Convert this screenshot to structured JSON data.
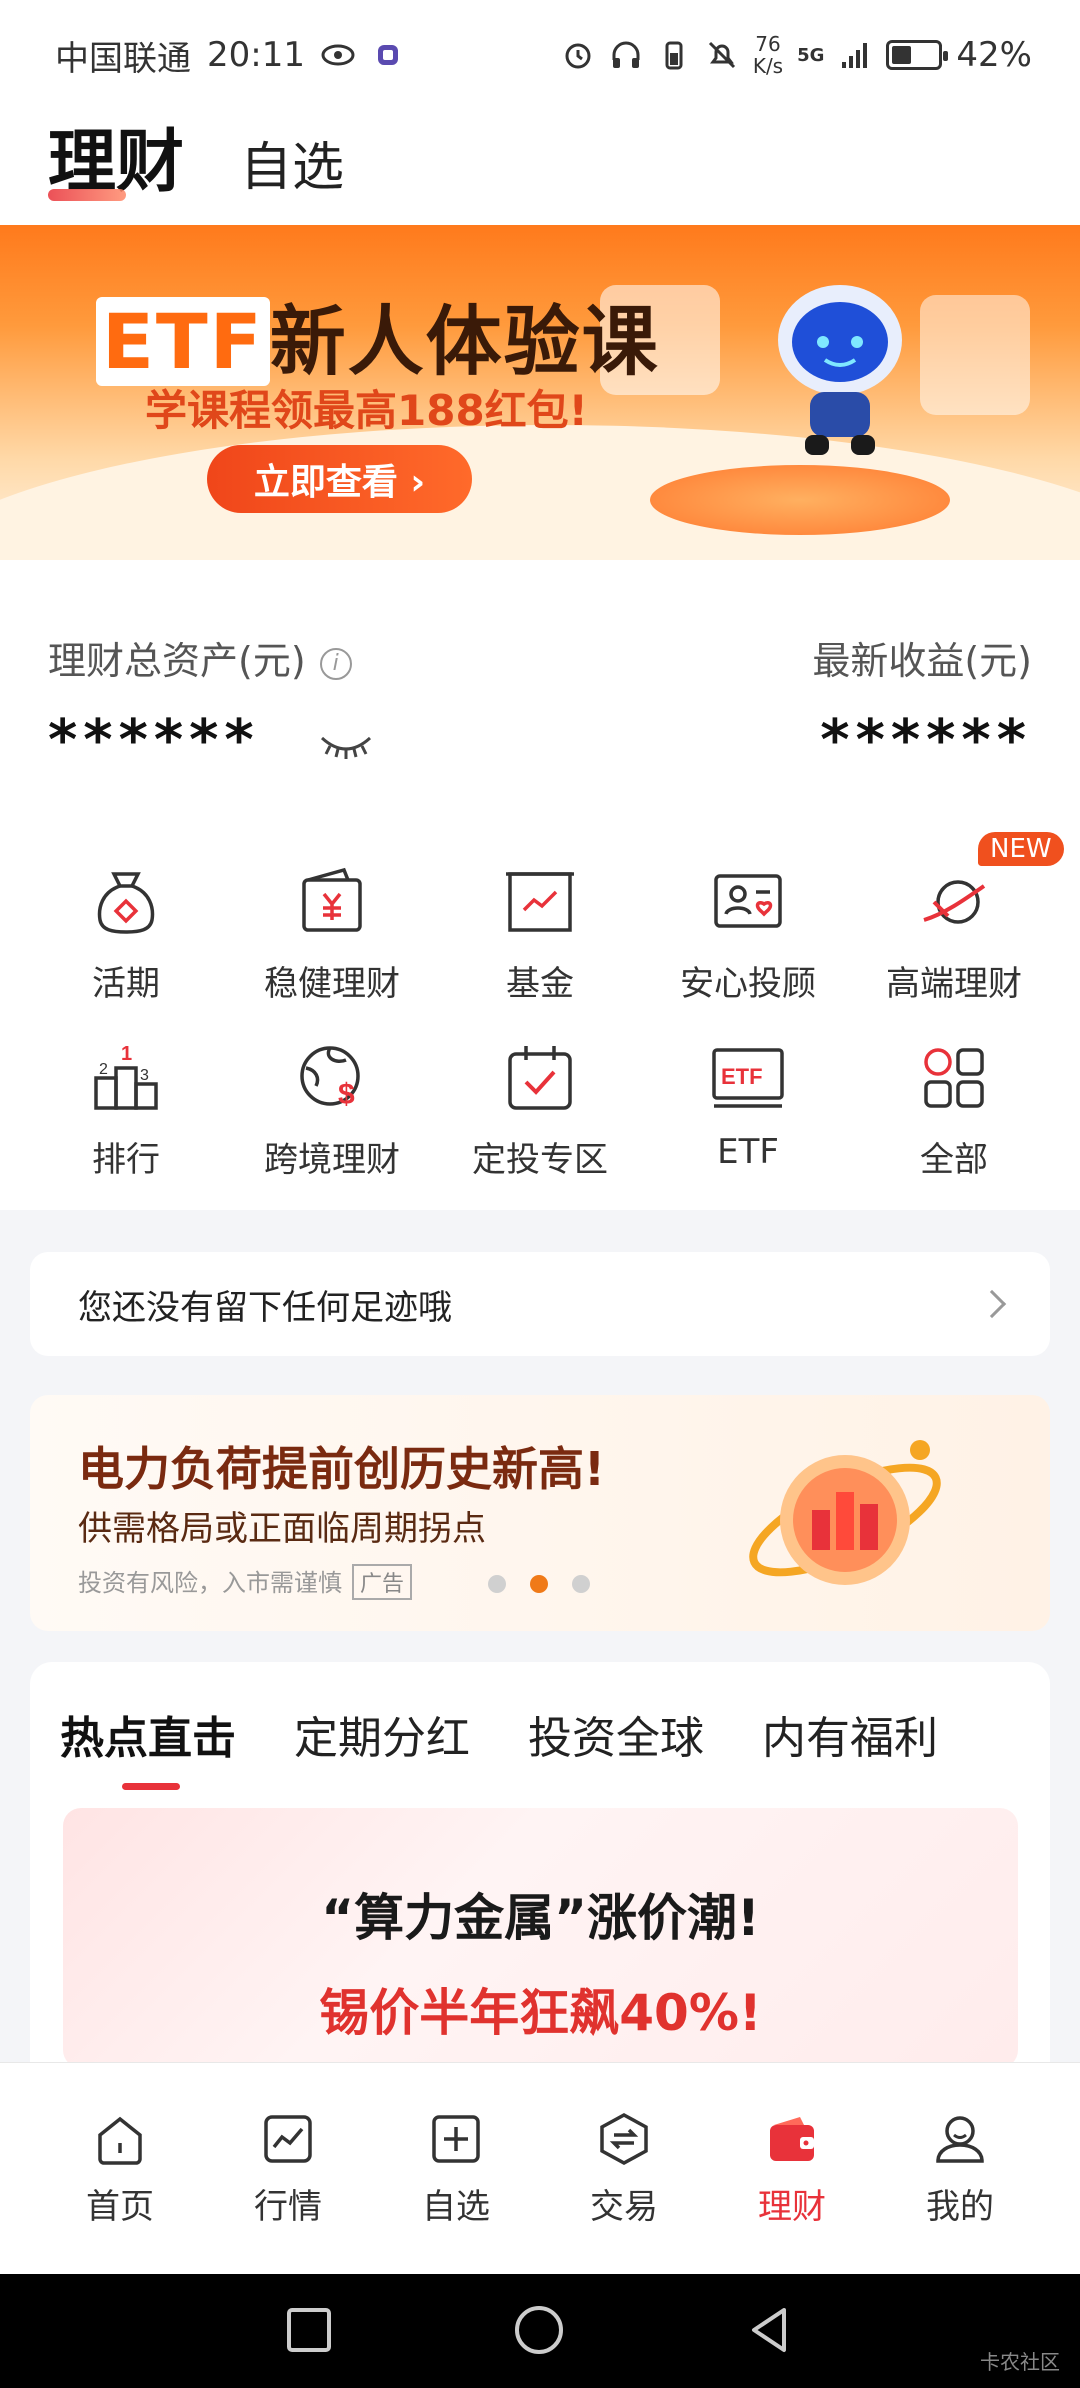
{
  "status_bar": {
    "carrier": "中国联通",
    "time": "20:11",
    "net_speed_value": "76",
    "net_speed_unit": "K/s",
    "signal": "5G",
    "battery": "42%",
    "battery_level": 0.42
  },
  "header": {
    "tab_active": "理财",
    "tab_other": "自选"
  },
  "banner": {
    "title_prefix": "ETF",
    "title": "新人体验课",
    "subtitle": "学课程领最高188红包!",
    "cta": "立即查看 ›"
  },
  "assets": {
    "total_label": "理财总资产(元)",
    "total_value": "******",
    "income_label": "最新收益(元)",
    "income_value": "******",
    "info_icon": "i"
  },
  "grid": {
    "items": [
      {
        "label": "活期",
        "icon": "money-bag-icon"
      },
      {
        "label": "稳健理财",
        "icon": "yen-wallet-icon"
      },
      {
        "label": "基金",
        "icon": "chart-frame-icon"
      },
      {
        "label": "安心投顾",
        "icon": "advisor-card-icon"
      },
      {
        "label": "高端理财",
        "icon": "premium-icon",
        "badge": "NEW"
      },
      {
        "label": "排行",
        "icon": "podium-icon"
      },
      {
        "label": "跨境理财",
        "icon": "globe-dollar-icon"
      },
      {
        "label": "定投专区",
        "icon": "calendar-check-icon"
      },
      {
        "label": "ETF",
        "icon": "etf-icon",
        "icon_text": "ETF"
      },
      {
        "label": "全部",
        "icon": "grid-all-icon"
      }
    ]
  },
  "footprint": {
    "text": "您还没有留下任何足迹哦"
  },
  "ad": {
    "headline": "电力负荷提前创历史新高!",
    "subline": "供需格局或正面临周期拐点",
    "disclaimer": "投资有风险，入市需谨慎",
    "ad_tag": "广告",
    "active_dot": 1,
    "dots": 3
  },
  "section": {
    "tabs": [
      "热点直击",
      "定期分红",
      "投资全球",
      "内有福利"
    ],
    "active_tab": 0,
    "promo_line1": "“算力金属”涨价潮!",
    "promo_line2": "锡价半年狂飙40%!"
  },
  "tabbar": {
    "items": [
      {
        "label": "首页",
        "icon": "home-icon"
      },
      {
        "label": "行情",
        "icon": "market-chart-icon"
      },
      {
        "label": "自选",
        "icon": "add-square-icon"
      },
      {
        "label": "交易",
        "icon": "exchange-icon"
      },
      {
        "label": "理财",
        "icon": "wallet-icon"
      },
      {
        "label": "我的",
        "icon": "profile-icon"
      }
    ],
    "active": 4
  },
  "watermark": "卡农社区",
  "colors": {
    "accent_red": "#e8323a",
    "banner_orange": "#ff7a1c",
    "ad_orange": "#f07a18"
  }
}
